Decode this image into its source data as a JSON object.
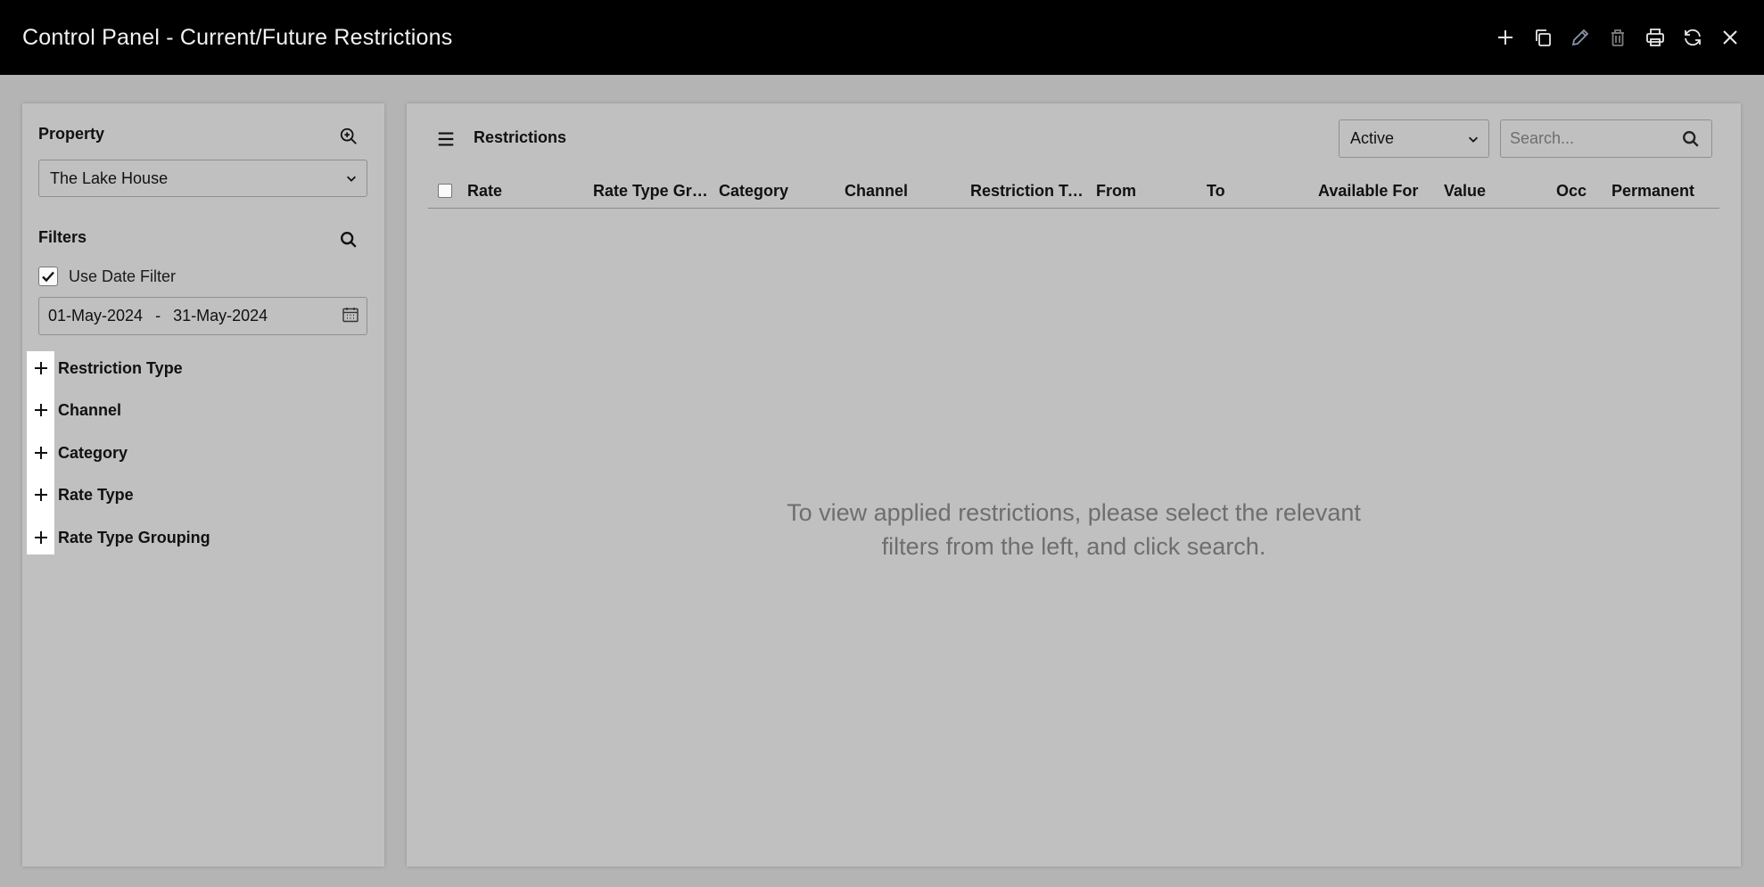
{
  "window": {
    "title": "Control Panel - Current/Future Restrictions",
    "actions": [
      {
        "name": "add-icon",
        "label": "Add"
      },
      {
        "name": "copy-icon",
        "label": "Copy"
      },
      {
        "name": "edit-icon",
        "label": "Edit"
      },
      {
        "name": "delete-icon",
        "label": "Delete"
      },
      {
        "name": "print-icon",
        "label": "Print"
      },
      {
        "name": "refresh-icon",
        "label": "Refresh"
      },
      {
        "name": "close-icon",
        "label": "Close"
      }
    ]
  },
  "left": {
    "property_label": "Property",
    "property_value": "The Lake House",
    "filters_label": "Filters",
    "use_date_filter_label": "Use Date Filter",
    "use_date_filter_checked": true,
    "date_from": "01-May-2024",
    "date_sep": "-",
    "date_to": "31-May-2024",
    "accordion": [
      {
        "label": "Restriction Type"
      },
      {
        "label": "Channel"
      },
      {
        "label": "Category"
      },
      {
        "label": "Rate Type"
      },
      {
        "label": "Rate Type Grouping"
      }
    ]
  },
  "main": {
    "title": "Restrictions",
    "status_select": "Active",
    "search_placeholder": "Search...",
    "columns": [
      "Rate",
      "Rate Type Gro...",
      "Category",
      "Channel",
      "Restriction Ty...",
      "From",
      "To",
      "Available For",
      "Value",
      "Occ",
      "Permanent"
    ],
    "empty_line1": "To view applied restrictions, please select the relevant",
    "empty_line2": "filters from the left, and click search."
  },
  "colors": {
    "titlebar": "#000000",
    "panel": "#c0c0c0",
    "background": "#b4b4b4",
    "edit_icon_muted": "#8a94a8",
    "empty_text": "#6e6e6e"
  }
}
